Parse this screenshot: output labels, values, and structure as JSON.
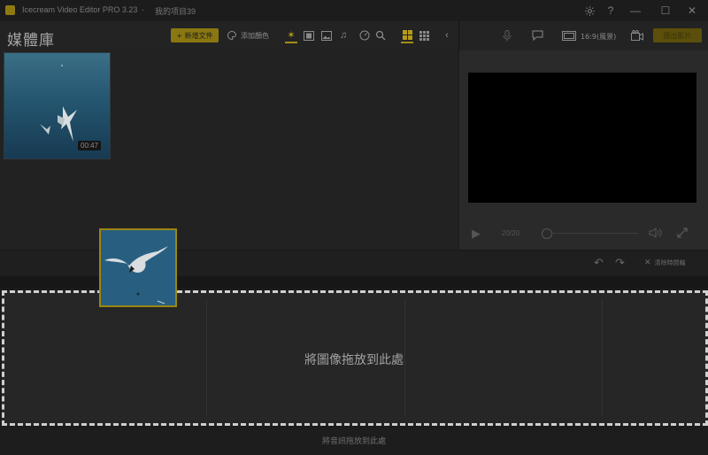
{
  "app": {
    "title": "Icecream Video Editor PRO 3.23",
    "separator": "-",
    "project": "我的项目39"
  },
  "window_controls": {
    "settings_icon": "gear-icon",
    "help_label": "?",
    "minimize_label": "—",
    "maximize_label": "☐",
    "close_label": "✕"
  },
  "toolbar": {
    "media_title": "媒體庫",
    "add_file_label": "+ 新增文件",
    "add_color_label": "添加顏色",
    "aspect_ratio": "16:9(風景)",
    "export_label": "匯出影片"
  },
  "media": {
    "items": [
      {
        "duration": "00:47"
      }
    ]
  },
  "preview": {
    "time": "20/20"
  },
  "timeline": {
    "clear_label": "清除時間軸",
    "drop_text": "將圖像拖放到此處",
    "audio_text": "將音訊拖放到此處"
  }
}
